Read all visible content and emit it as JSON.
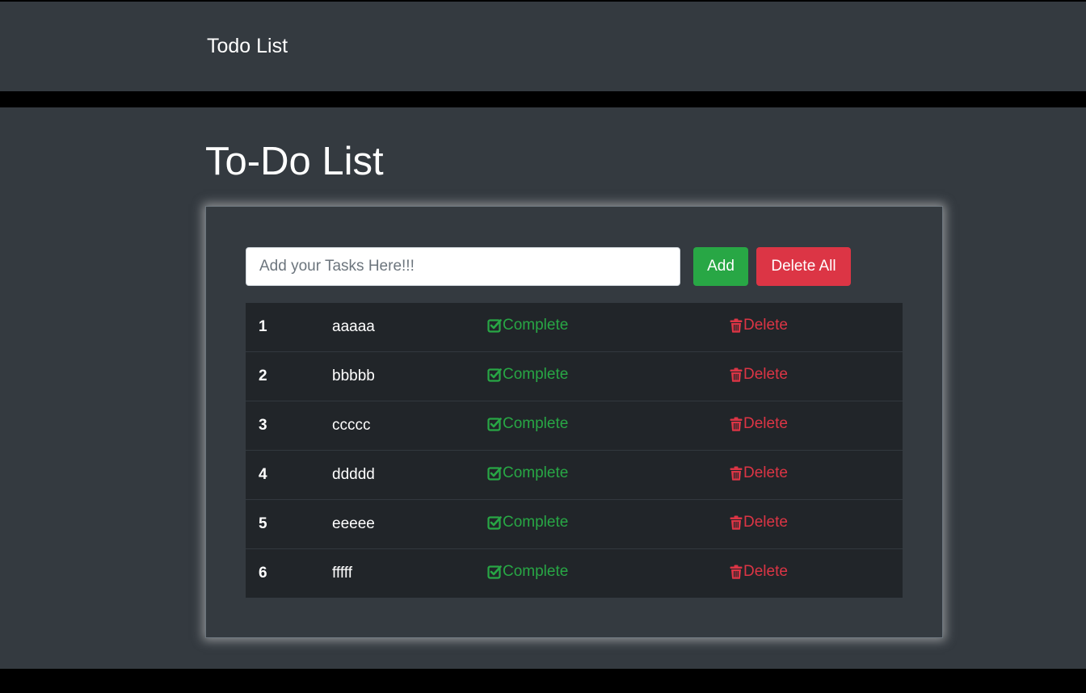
{
  "navbar": {
    "brand": "Todo List"
  },
  "main": {
    "title": "To-Do List"
  },
  "form": {
    "placeholder": "Add your Tasks Here!!!",
    "value": "",
    "add_label": "Add",
    "delete_all_label": "Delete All"
  },
  "tasks": [
    {
      "num": "1",
      "name": "aaaaa",
      "complete_label": "Complete",
      "delete_label": "Delete"
    },
    {
      "num": "2",
      "name": "bbbbb",
      "complete_label": "Complete",
      "delete_label": "Delete"
    },
    {
      "num": "3",
      "name": "ccccc",
      "complete_label": "Complete",
      "delete_label": "Delete"
    },
    {
      "num": "4",
      "name": "ddddd",
      "complete_label": "Complete",
      "delete_label": "Delete"
    },
    {
      "num": "5",
      "name": "eeeee",
      "complete_label": "Complete",
      "delete_label": "Delete"
    },
    {
      "num": "6",
      "name": "fffff",
      "complete_label": "Complete",
      "delete_label": "Delete"
    }
  ],
  "icons": {
    "complete": "check-square-icon",
    "delete": "trash-icon"
  },
  "colors": {
    "background": "#343a40",
    "table": "#212529",
    "success": "#28a745",
    "danger": "#dc3545",
    "text": "#ffffff"
  }
}
